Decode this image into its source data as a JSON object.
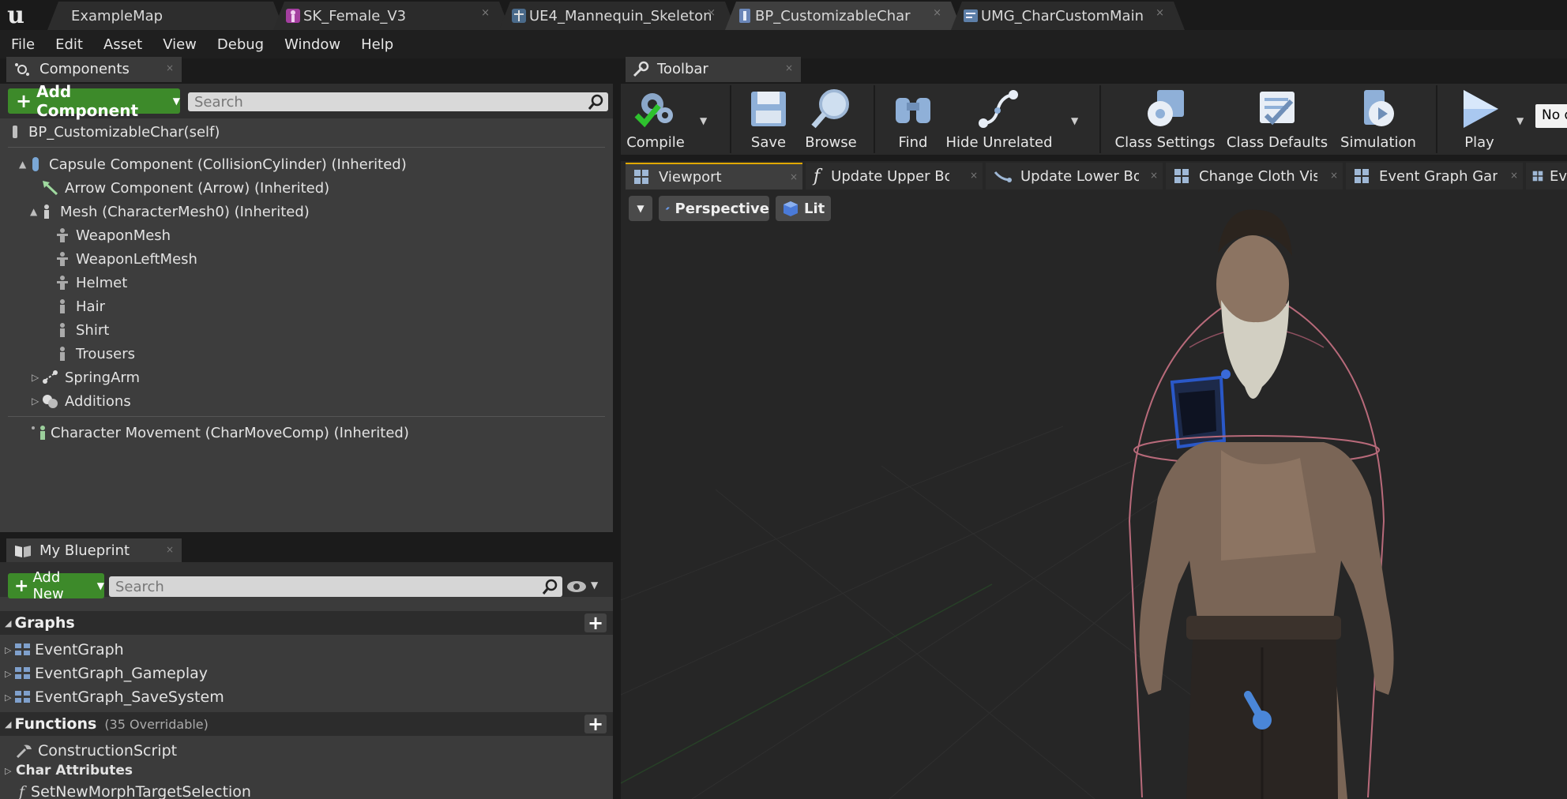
{
  "tabs": [
    {
      "label": "ExampleMap",
      "icon": "map-icon",
      "close": ""
    },
    {
      "label": "SK_Female_V3",
      "icon": "skeletal-mesh-icon",
      "close": "×"
    },
    {
      "label": "UE4_Mannequin_Skeleton",
      "icon": "skeleton-icon",
      "close": "×"
    },
    {
      "label": "BP_CustomizableChar",
      "icon": "blueprint-icon",
      "close": "×"
    },
    {
      "label": "UMG_CharCustomMain",
      "icon": "widget-blueprint-icon",
      "close": "×"
    }
  ],
  "menu": [
    "File",
    "Edit",
    "Asset",
    "View",
    "Debug",
    "Window",
    "Help"
  ],
  "components": {
    "panel_title": "Components",
    "add_label": "Add Component",
    "search_placeholder": "Search",
    "self_item": "BP_CustomizableChar(self)",
    "tree": [
      {
        "label": "Capsule Component (CollisionCylinder) (Inherited)",
        "expand": "▲",
        "icon": "capsule-icon"
      },
      {
        "label": "Arrow Component (Arrow) (Inherited)",
        "expand": "",
        "icon": "arrow-component-icon"
      },
      {
        "label": "Mesh (CharacterMesh0) (Inherited)",
        "expand": "▲",
        "icon": "mesh-icon"
      },
      {
        "label": "WeaponMesh",
        "expand": "",
        "icon": "skeletal-mesh-icon"
      },
      {
        "label": "WeaponLeftMesh",
        "expand": "",
        "icon": "skeletal-mesh-icon"
      },
      {
        "label": "Helmet",
        "expand": "",
        "icon": "skeletal-mesh-icon"
      },
      {
        "label": "Hair",
        "expand": "",
        "icon": "skeletal-mesh-icon"
      },
      {
        "label": "Shirt",
        "expand": "",
        "icon": "skeletal-mesh-icon"
      },
      {
        "label": "Trousers",
        "expand": "",
        "icon": "skeletal-mesh-icon"
      },
      {
        "label": "SpringArm",
        "expand": "▷",
        "icon": "spring-arm-icon"
      },
      {
        "label": "Additions",
        "expand": "▷",
        "icon": "scene-component-icon"
      }
    ],
    "movement_item": "Character Movement (CharMoveComp) (Inherited)"
  },
  "my_blueprint": {
    "panel_title": "My Blueprint",
    "add_label": "Add New",
    "search_placeholder": "Search",
    "graphs_header": "Graphs",
    "graphs": [
      "EventGraph",
      "EventGraph_Gameplay",
      "EventGraph_SaveSystem"
    ],
    "functions_header": "Functions",
    "functions_count": "(35 Overridable)",
    "functions": [
      "ConstructionScript"
    ],
    "category": "Char Attributes",
    "category_items": [
      "SetNewMorphTargetSelection"
    ]
  },
  "toolbar": {
    "panel_title": "Toolbar",
    "buttons": [
      "Compile",
      "Save",
      "Browse",
      "Find",
      "Hide Unrelated",
      "Class Settings",
      "Class Defaults",
      "Simulation",
      "Play"
    ],
    "debug_filter": "No debug object selected"
  },
  "editor_tabs": [
    "Viewport",
    "Update Upper Body",
    "Update Lower Body",
    "Change Cloth Visib",
    "Event Graph Gamep",
    "Ev"
  ],
  "viewport": {
    "perspective_label": "Perspective",
    "lit_label": "Lit"
  },
  "colors": {
    "accent_green": "#3d8a2a",
    "panel_bg": "#3d3d3d",
    "active_tab": "#3f3f3f",
    "tab_bar": "#1a1a1a"
  }
}
